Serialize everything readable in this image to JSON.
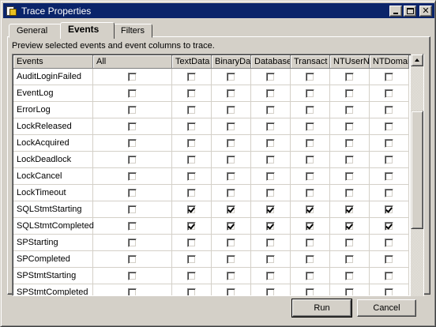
{
  "window": {
    "title": "Trace Properties"
  },
  "tabs": [
    {
      "label": "General"
    },
    {
      "label": "Events"
    },
    {
      "label": "Filters"
    }
  ],
  "hint": "Preview selected events and event columns to trace.",
  "columns": [
    "Events",
    "All",
    "TextData",
    "BinaryDa",
    "Database",
    "Transact",
    "NTUserN",
    "NTDomai"
  ],
  "rows": [
    {
      "name": "AuditLoginFailed",
      "checks": [
        false,
        false,
        false,
        false,
        false,
        false,
        false
      ]
    },
    {
      "name": "EventLog",
      "checks": [
        false,
        false,
        false,
        false,
        false,
        false,
        false
      ]
    },
    {
      "name": "ErrorLog",
      "checks": [
        false,
        false,
        false,
        false,
        false,
        false,
        false
      ]
    },
    {
      "name": "LockReleased",
      "checks": [
        false,
        false,
        false,
        false,
        false,
        false,
        false
      ]
    },
    {
      "name": "LockAcquired",
      "checks": [
        false,
        false,
        false,
        false,
        false,
        false,
        false
      ]
    },
    {
      "name": "LockDeadlock",
      "checks": [
        false,
        false,
        false,
        false,
        false,
        false,
        false
      ]
    },
    {
      "name": "LockCancel",
      "checks": [
        false,
        false,
        false,
        false,
        false,
        false,
        false
      ]
    },
    {
      "name": "LockTimeout",
      "checks": [
        false,
        false,
        false,
        false,
        false,
        false,
        false
      ]
    },
    {
      "name": "SQLStmtStarting",
      "checks": [
        false,
        true,
        true,
        true,
        true,
        true,
        true
      ]
    },
    {
      "name": "SQLStmtCompleted",
      "checks": [
        false,
        true,
        true,
        true,
        true,
        true,
        true
      ]
    },
    {
      "name": "SPStarting",
      "checks": [
        false,
        false,
        false,
        false,
        false,
        false,
        false
      ]
    },
    {
      "name": "SPCompleted",
      "checks": [
        false,
        false,
        false,
        false,
        false,
        false,
        false
      ]
    },
    {
      "name": "SPStmtStarting",
      "checks": [
        false,
        false,
        false,
        false,
        false,
        false,
        false
      ]
    },
    {
      "name": "SPStmtCompleted",
      "checks": [
        false,
        false,
        false,
        false,
        false,
        false,
        false
      ]
    }
  ],
  "buttons": {
    "run": "Run",
    "cancel": "Cancel"
  },
  "icons": {
    "app": "trace-app-icon",
    "minimize": "minimize-icon",
    "maximize": "maximize-icon",
    "close": "close-icon",
    "scroll_up": "arrow-up-icon"
  },
  "colors": {
    "titlebar": "#0a246a",
    "face": "#d4d0c8"
  }
}
